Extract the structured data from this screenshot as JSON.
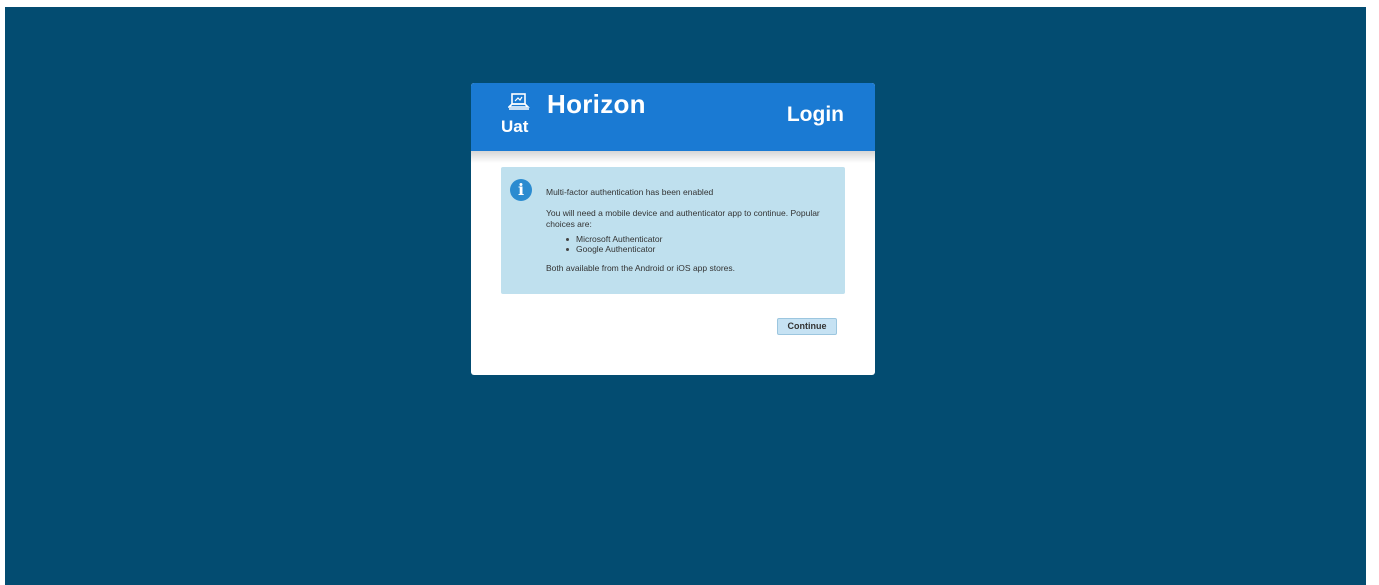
{
  "header": {
    "logo_icon": "laptop-icon",
    "env_label": "Uat",
    "app_title": "Horizon",
    "page_title": "Login"
  },
  "info": {
    "icon": "info-icon",
    "icon_glyph": "i",
    "heading": "Multi-factor authentication has been enabled",
    "lead": "You will need a mobile device and authenticator app to continue. Popular choices are:",
    "apps": [
      "Microsoft Authenticator",
      "Google Authenticator"
    ],
    "footer": "Both available from the Android or iOS app stores."
  },
  "actions": {
    "continue_label": "Continue"
  },
  "colors": {
    "page_background": "#034c71",
    "header_background": "#1a7ad3",
    "info_background": "#bfe0ee",
    "button_background": "#c6e2f3"
  }
}
